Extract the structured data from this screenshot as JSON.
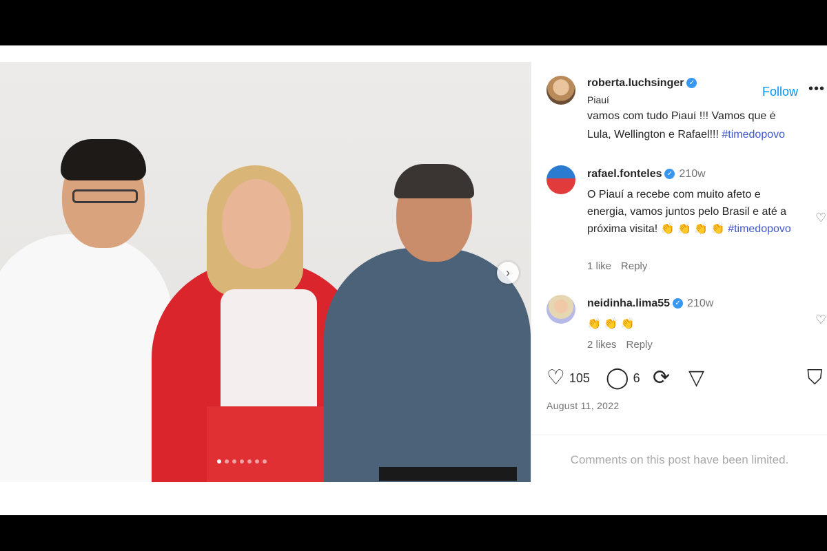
{
  "post": {
    "username": "roberta.luchsinger",
    "location": "Piauí",
    "follow_label": "Follow",
    "more_label": "•••",
    "caption_partial": "vamos com tudo Piauí !!! Vamos que é",
    "caption_line": "Lula, Wellington e Rafael!!!",
    "caption_hashtag": "#timedopovo",
    "carousel_dots": 7,
    "carousel_active_index": 0,
    "next_icon": "chevron-right-icon"
  },
  "comments": [
    {
      "username": "rafael.fonteles",
      "time": "210w",
      "text": "O Piauí a recebe com muito afeto e energia, vamos juntos pelo Brasil e até a próxima visita! 👏 👏 👏 👏",
      "hashtag": "#timedopovo",
      "likes": "1 like",
      "reply": "Reply"
    },
    {
      "username": "neidinha.lima55",
      "time": "210w",
      "text": "👏 👏 👏",
      "likes": "2 likes",
      "reply": "Reply"
    }
  ],
  "actions": {
    "like_count": "105",
    "comment_count": "6",
    "date": "August 11, 2022",
    "comments_limited": "Comments on this post have been limited."
  },
  "colors": {
    "link": "#0095f6",
    "hashtag": "#4157c9",
    "muted": "#737373",
    "verified": "#3897f0"
  }
}
